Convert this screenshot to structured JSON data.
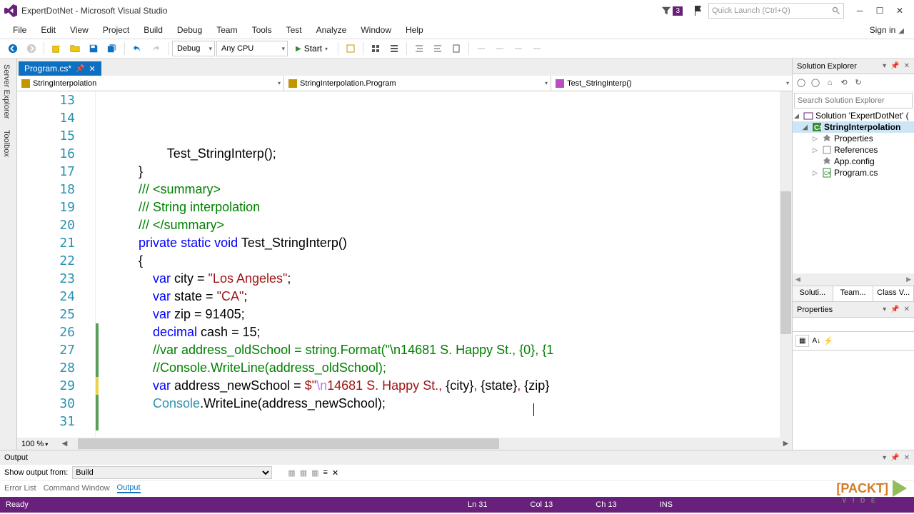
{
  "title": "ExpertDotNet - Microsoft Visual Studio",
  "quicklaunch_placeholder": "Quick Launch (Ctrl+Q)",
  "badge": "3",
  "menu": [
    "File",
    "Edit",
    "View",
    "Project",
    "Build",
    "Debug",
    "Team",
    "Tools",
    "Test",
    "Analyze",
    "Window",
    "Help"
  ],
  "signin": "Sign in",
  "config": "Debug",
  "platform": "Any CPU",
  "start": "Start",
  "doc_tab": "Program.cs*",
  "nav": {
    "ns": "StringInterpolation",
    "cls": "StringInterpolation.Program",
    "mtd": "Test_StringInterp()"
  },
  "zoom": "100 %",
  "line_start": 13,
  "code": [
    {
      "n": 13,
      "indent": 4,
      "t": [
        {
          "c": "",
          "s": "Test_StringInterp();"
        }
      ]
    },
    {
      "n": 14,
      "indent": 2,
      "t": [
        {
          "c": "",
          "s": "}"
        }
      ]
    },
    {
      "n": 15,
      "indent": 0,
      "t": []
    },
    {
      "n": 16,
      "indent": 2,
      "fold": true,
      "t": [
        {
          "c": "cmt",
          "s": "/// <summary>"
        }
      ]
    },
    {
      "n": 17,
      "indent": 2,
      "t": [
        {
          "c": "cmt",
          "s": "/// "
        },
        {
          "c": "cmt",
          "s": "String interpolation"
        }
      ]
    },
    {
      "n": 18,
      "indent": 2,
      "t": [
        {
          "c": "cmt",
          "s": "/// </summary>"
        }
      ]
    },
    {
      "n": 19,
      "indent": 2,
      "fold": true,
      "t": [
        {
          "c": "kw",
          "s": "private"
        },
        {
          "c": "",
          "s": " "
        },
        {
          "c": "kw",
          "s": "static"
        },
        {
          "c": "",
          "s": " "
        },
        {
          "c": "kw",
          "s": "void"
        },
        {
          "c": "",
          "s": " Test_StringInterp()"
        }
      ]
    },
    {
      "n": 20,
      "indent": 2,
      "t": [
        {
          "c": "",
          "s": "{"
        }
      ]
    },
    {
      "n": 21,
      "indent": 3,
      "t": [
        {
          "c": "kw",
          "s": "var"
        },
        {
          "c": "",
          "s": " city = "
        },
        {
          "c": "str",
          "s": "\"Los Angeles\""
        },
        {
          "c": "",
          "s": ";"
        }
      ]
    },
    {
      "n": 22,
      "indent": 3,
      "t": [
        {
          "c": "kw",
          "s": "var"
        },
        {
          "c": "",
          "s": " state = "
        },
        {
          "c": "str",
          "s": "\"CA\""
        },
        {
          "c": "",
          "s": ";"
        }
      ]
    },
    {
      "n": 23,
      "indent": 3,
      "t": [
        {
          "c": "kw",
          "s": "var"
        },
        {
          "c": "",
          "s": " zip = 91405;"
        }
      ]
    },
    {
      "n": 24,
      "indent": 3,
      "t": [
        {
          "c": "kw",
          "s": "decimal"
        },
        {
          "c": "",
          "s": " cash = 15;"
        }
      ]
    },
    {
      "n": 25,
      "indent": 0,
      "t": []
    },
    {
      "n": 26,
      "indent": 3,
      "bar": "green",
      "t": [
        {
          "c": "cmt",
          "s": "//var address_oldSchool = string.Format(\"\\n14681 S. Happy St., {0}, {1"
        }
      ]
    },
    {
      "n": 27,
      "indent": 3,
      "bar": "green",
      "t": [
        {
          "c": "cmt",
          "s": "//Console.WriteLine(address_oldSchool);"
        }
      ]
    },
    {
      "n": 28,
      "indent": 0,
      "bar": "green",
      "t": []
    },
    {
      "n": 29,
      "indent": 3,
      "bar": "yellow",
      "t": [
        {
          "c": "kw",
          "s": "var"
        },
        {
          "c": "",
          "s": " address_newSchool = "
        },
        {
          "c": "str",
          "s": "$\""
        },
        {
          "c": "esc",
          "s": "\\n"
        },
        {
          "c": "str",
          "s": "14681 S. Happy St., "
        },
        {
          "c": "",
          "s": "{city}"
        },
        {
          "c": "str",
          "s": ", "
        },
        {
          "c": "",
          "s": "{state}"
        },
        {
          "c": "str",
          "s": ", "
        },
        {
          "c": "",
          "s": "{zip}"
        }
      ]
    },
    {
      "n": 30,
      "indent": 3,
      "bar": "green",
      "t": [
        {
          "c": "typ",
          "s": "Console"
        },
        {
          "c": "",
          "s": ".WriteLine(address_newSchool);"
        }
      ]
    },
    {
      "n": 31,
      "indent": 3,
      "bar": "green",
      "t": []
    }
  ],
  "solution_explorer": {
    "title": "Solution Explorer",
    "search_placeholder": "Search Solution Explorer",
    "root": "Solution 'ExpertDotNet' (",
    "project": "StringInterpolation",
    "items": [
      "Properties",
      "References",
      "App.config",
      "Program.cs"
    ]
  },
  "panel_tabs": [
    "Soluti...",
    "Team...",
    "Class V..."
  ],
  "properties_title": "Properties",
  "output": {
    "title": "Output",
    "show_from": "Show output from:",
    "source": "Build",
    "tabs": [
      "Error List",
      "Command Window",
      "Output"
    ]
  },
  "status": {
    "ready": "Ready",
    "ln": "Ln 31",
    "col": "Col 13",
    "ch": "Ch 13",
    "ins": "INS"
  },
  "watermark": "[PACKT]"
}
